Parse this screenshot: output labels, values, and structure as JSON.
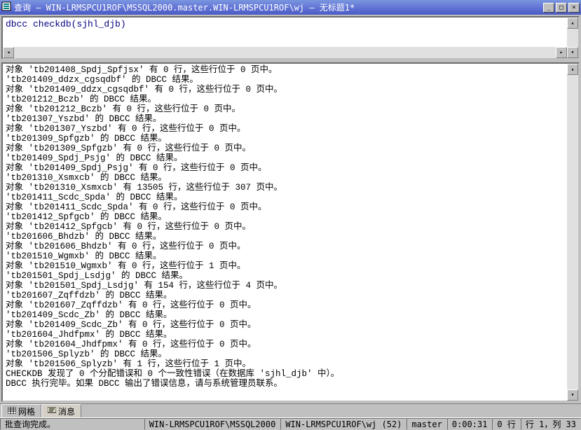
{
  "window": {
    "title": "查询 — WIN-LRMSPCU1ROF\\MSSQL2000.master.WIN-LRMSPCU1ROF\\wj — 无标题1*"
  },
  "query": {
    "text": "dbcc checkdb(sjhl_djb)"
  },
  "results": {
    "lines": [
      "对象 'tb201408_Spdj_Spfjsx' 有 0 行，这些行位于 0 页中。",
      "'tb201409_ddzx_cgsqdbf' 的 DBCC 结果。",
      "对象 'tb201409_ddzx_cgsqdbf' 有 0 行，这些行位于 0 页中。",
      "'tb201212_Bczb' 的 DBCC 结果。",
      "对象 'tb201212_Bczb' 有 0 行，这些行位于 0 页中。",
      "'tb201307_Yszbd' 的 DBCC 结果。",
      "对象 'tb201307_Yszbd' 有 0 行，这些行位于 0 页中。",
      "'tb201309_Spfgzb' 的 DBCC 结果。",
      "对象 'tb201309_Spfgzb' 有 0 行，这些行位于 0 页中。",
      "'tb201409_Spdj_Psjg' 的 DBCC 结果。",
      "对象 'tb201409_Spdj_Psjg' 有 0 行，这些行位于 0 页中。",
      "'tb201310_Xsmxcb' 的 DBCC 结果。",
      "对象 'tb201310_Xsmxcb' 有 13505 行，这些行位于 307 页中。",
      "'tb201411_Scdc_Spda' 的 DBCC 结果。",
      "对象 'tb201411_Scdc_Spda' 有 0 行，这些行位于 0 页中。",
      "'tb201412_Spfgcb' 的 DBCC 结果。",
      "对象 'tb201412_Spfgcb' 有 0 行，这些行位于 0 页中。",
      "'tb201606_Bhdzb' 的 DBCC 结果。",
      "对象 'tb201606_Bhdzb' 有 0 行，这些行位于 0 页中。",
      "'tb201510_Wgmxb' 的 DBCC 结果。",
      "对象 'tb201510_Wgmxb' 有 0 行，这些行位于 1 页中。",
      "'tb201501_Spdj_Lsdjg' 的 DBCC 结果。",
      "对象 'tb201501_Spdj_Lsdjg' 有 154 行，这些行位于 4 页中。",
      "'tb201607_Zqffdzb' 的 DBCC 结果。",
      "对象 'tb201607_Zqffdzb' 有 0 行，这些行位于 0 页中。",
      "'tb201409_Scdc_Zb' 的 DBCC 结果。",
      "对象 'tb201409_Scdc_Zb' 有 0 行，这些行位于 0 页中。",
      "'tb201604_Jhdfpmx' 的 DBCC 结果。",
      "对象 'tb201604_Jhdfpmx' 有 0 行，这些行位于 0 页中。",
      "'tb201506_Splyzb' 的 DBCC 结果。",
      "对象 'tb201506_Splyzb' 有 1 行，这些行位于 1 页中。",
      "CHECKDB 发现了 0 个分配错误和 0 个一致性错误（在数据库 'sjhl_djb' 中）。",
      "DBCC 执行完毕。如果 DBCC 输出了错误信息，请与系统管理员联系。"
    ]
  },
  "tabs": {
    "grid": "网格",
    "messages": "消息"
  },
  "status": {
    "main": "批查询完成。",
    "server": "WIN-LRMSPCU1ROF\\MSSQL2000",
    "user": "WIN-LRMSPCU1ROF\\wj (52)",
    "db": "master",
    "time": "0:00:31",
    "rows": "0 行",
    "pos": "行 1，列 33"
  }
}
